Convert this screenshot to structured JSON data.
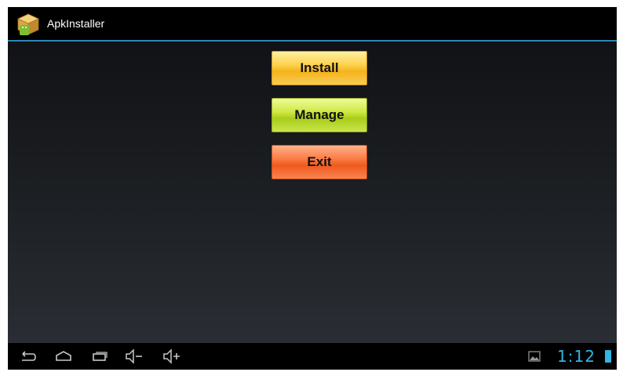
{
  "app": {
    "title": "ApkInstaller",
    "icon": "package-box-icon"
  },
  "buttons": {
    "install_label": "Install",
    "manage_label": "Manage",
    "exit_label": "Exit"
  },
  "navigation_bar": {
    "icons": [
      "back-icon",
      "home-icon",
      "recent-apps-icon",
      "volume-down-icon",
      "volume-up-icon"
    ]
  },
  "status_bar": {
    "notification_icon": "gallery-icon",
    "time": "1:12",
    "battery_icon": "battery-icon"
  },
  "colors": {
    "accent": "#33b5e5",
    "title_divider": "#2e88b5",
    "install_button": "#f9c940",
    "manage_button": "#c5e03a",
    "exit_button": "#f56a2e"
  }
}
